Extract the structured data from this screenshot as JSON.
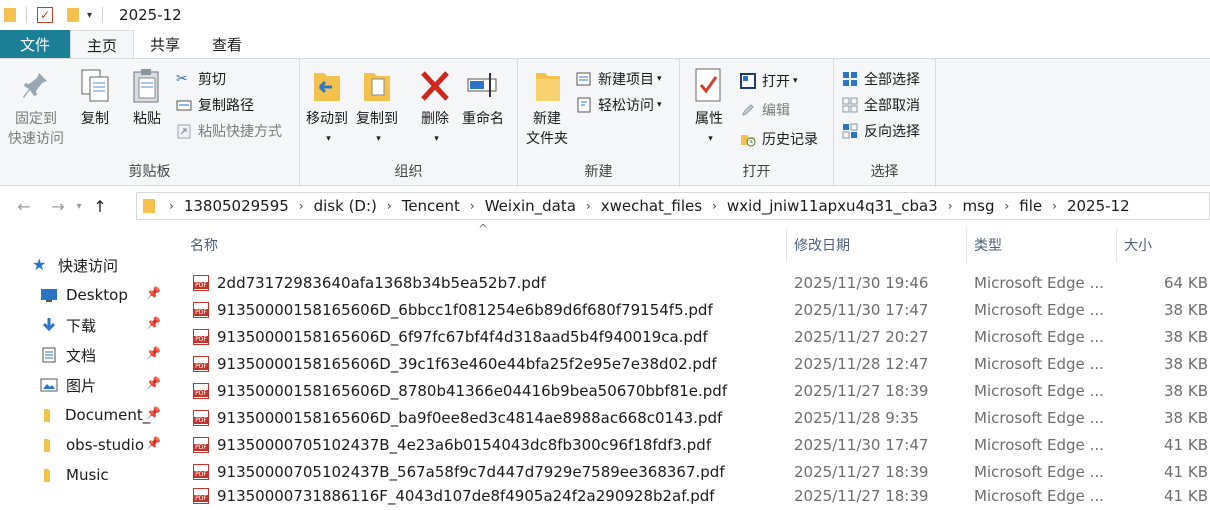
{
  "title": "2025-12",
  "ribbon_tabs": [
    "文件",
    "主页",
    "共享",
    "查看"
  ],
  "clipboard": {
    "label": "剪贴板",
    "pin": "固定到\n快速访问",
    "pin_l1": "固定到",
    "pin_l2": "快速访问",
    "copy": "复制",
    "paste": "粘贴",
    "cut": "剪切",
    "copy_path": "复制路径",
    "paste_shortcut": "粘贴快捷方式"
  },
  "organize": {
    "label": "组织",
    "move_to": "移动到",
    "copy_to": "复制到",
    "delete": "删除",
    "rename": "重命名"
  },
  "new_group": {
    "label": "新建",
    "new_folder_l1": "新建",
    "new_folder_l2": "文件夹",
    "new_item": "新建项目",
    "easy_access": "轻松访问"
  },
  "open_group": {
    "label": "打开",
    "properties": "属性",
    "open": "打开",
    "edit": "编辑",
    "history": "历史记录"
  },
  "select_group": {
    "label": "选择",
    "select_all": "全部选择",
    "select_none": "全部取消",
    "invert": "反向选择"
  },
  "breadcrumb": [
    "13805029595",
    "disk (D:)",
    "Tencent",
    "Weixin_data",
    "xwechat_files",
    "wxid_jniw11apxu4q31_cba3",
    "msg",
    "file",
    "2025-12"
  ],
  "columns": {
    "name": "名称",
    "date": "修改日期",
    "type": "类型",
    "size": "大小"
  },
  "sidebar": [
    {
      "label": "快速访问",
      "icon": "star-icon"
    },
    {
      "label": "Desktop",
      "icon": "desktop-icon"
    },
    {
      "label": "下载",
      "icon": "download-icon"
    },
    {
      "label": "文档",
      "icon": "document-icon"
    },
    {
      "label": "图片",
      "icon": "picture-icon"
    },
    {
      "label": "Document_",
      "icon": "folder-icon"
    },
    {
      "label": "obs-studio",
      "icon": "folder-icon"
    },
    {
      "label": "Music",
      "icon": "folder-icon"
    }
  ],
  "files": [
    {
      "name": "2dd73172983640afa1368b34b5ea52b7.pdf",
      "date": "2025/11/30 19:46",
      "type": "Microsoft Edge ...",
      "size": "64 KB"
    },
    {
      "name": "91350000158165606D_6bbcc1f081254e6b89d6f680f79154f5.pdf",
      "date": "2025/11/30 17:47",
      "type": "Microsoft Edge ...",
      "size": "38 KB"
    },
    {
      "name": "91350000158165606D_6f97fc67bf4f4d318aad5b4f940019ca.pdf",
      "date": "2025/11/27 20:27",
      "type": "Microsoft Edge ...",
      "size": "38 KB"
    },
    {
      "name": "91350000158165606D_39c1f63e460e44bfa25f2e95e7e38d02.pdf",
      "date": "2025/11/28 12:47",
      "type": "Microsoft Edge ...",
      "size": "38 KB"
    },
    {
      "name": "91350000158165606D_8780b41366e04416b9bea50670bbf81e.pdf",
      "date": "2025/11/27 18:39",
      "type": "Microsoft Edge ...",
      "size": "38 KB"
    },
    {
      "name": "91350000158165606D_ba9f0ee8ed3c4814ae8988ac668c0143.pdf",
      "date": "2025/11/28 9:35",
      "type": "Microsoft Edge ...",
      "size": "38 KB"
    },
    {
      "name": "91350000705102437B_4e23a6b0154043dc8fb300c96f18fdf3.pdf",
      "date": "2025/11/30 17:47",
      "type": "Microsoft Edge ...",
      "size": "41 KB"
    },
    {
      "name": "91350000705102437B_567a58f9c7d447d7929e7589ee368367.pdf",
      "date": "2025/11/27 18:39",
      "type": "Microsoft Edge ...",
      "size": "41 KB"
    },
    {
      "name": "91350000731886116F_4043d107de8f4905a24f2a290928b2af.pdf",
      "date": "2025/11/27 18:39",
      "type": "Microsoft Edge ...",
      "size": "41 KB"
    }
  ],
  "colors": {
    "file_tab": "#1b7f95",
    "pdf_red": "#c2342b",
    "folder": "#f4c24c",
    "accent_blue": "#2b74c7"
  }
}
